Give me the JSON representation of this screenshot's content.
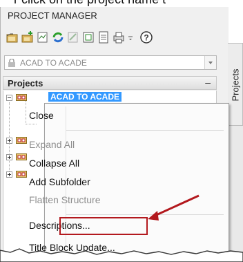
{
  "banner": {
    "text": "r click on the project name t"
  },
  "panel": {
    "title": "PROJECT MANAGER",
    "side_tab_label": "Projects"
  },
  "toolbar": {
    "icons": [
      "open-project-icon",
      "new-project-icon",
      "project-properties-icon",
      "refresh-icon",
      "publish-icon",
      "settings-icon",
      "title-block-icon",
      "print-icon",
      "dropdown-icon",
      "help-icon"
    ]
  },
  "project_selector": {
    "value": "ACAD TO ACADE"
  },
  "projects_section": {
    "label": "Projects",
    "collapse_glyph": "–"
  },
  "tree": {
    "active_project": "ACAD TO ACADE"
  },
  "context_menu": {
    "items": [
      {
        "label": "Close",
        "enabled": true
      },
      {
        "label": "Expand All",
        "enabled": false
      },
      {
        "label": "Collapse All",
        "enabled": true
      },
      {
        "label": "Add Subfolder",
        "enabled": true
      },
      {
        "label": "Flatten Structure",
        "enabled": false
      },
      {
        "label": "Descriptions...",
        "enabled": true
      },
      {
        "label": "Title Block Update...",
        "enabled": true
      }
    ]
  },
  "colors": {
    "highlight": "#3399ff",
    "annotation": "#b3191e"
  }
}
